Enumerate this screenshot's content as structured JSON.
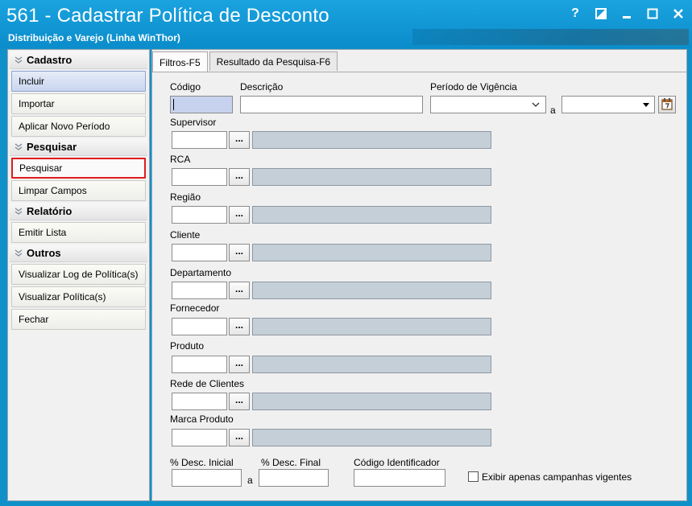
{
  "window": {
    "title": "561 - Cadastrar Política de Desconto",
    "subtitle": "Distribuição e Varejo (Linha WinThor)",
    "help_label": "?"
  },
  "sidebar": {
    "sections": [
      {
        "title": "Cadastro",
        "items": [
          "Incluir",
          "Importar",
          "Aplicar Novo Período"
        ]
      },
      {
        "title": "Pesquisar",
        "items": [
          "Pesquisar",
          "Limpar Campos"
        ]
      },
      {
        "title": "Relatório",
        "items": [
          "Emitir Lista"
        ]
      },
      {
        "title": "Outros",
        "items": [
          "Visualizar Log de Política(s)",
          "Visualizar Política(s)",
          "Fechar"
        ]
      }
    ]
  },
  "tabs": [
    "Filtros-F5",
    "Resultado da Pesquisa-F6"
  ],
  "form": {
    "codigo_label": "Código",
    "descricao_label": "Descrição",
    "periodo_label": "Período de Vigência",
    "a_label": "a",
    "supervisor_label": "Supervisor",
    "rca_label": "RCA",
    "regiao_label": "Região",
    "cliente_label": "Cliente",
    "departamento_label": "Departamento",
    "fornecedor_label": "Fornecedor",
    "produto_label": "Produto",
    "rede_label": "Rede de Clientes",
    "marca_label": "Marca Produto",
    "desc_inicial_label": "% Desc. Inicial",
    "desc_final_label": "% Desc. Final",
    "codigo_ident_label": "Código Identificador",
    "exibir_label": "Exibir apenas campanhas vigentes",
    "dots_label": "..."
  },
  "colors": {
    "titlebar": "#0b8ccb",
    "highlight_border": "#e01b1b",
    "lookup_field": "#c5cfd8"
  }
}
